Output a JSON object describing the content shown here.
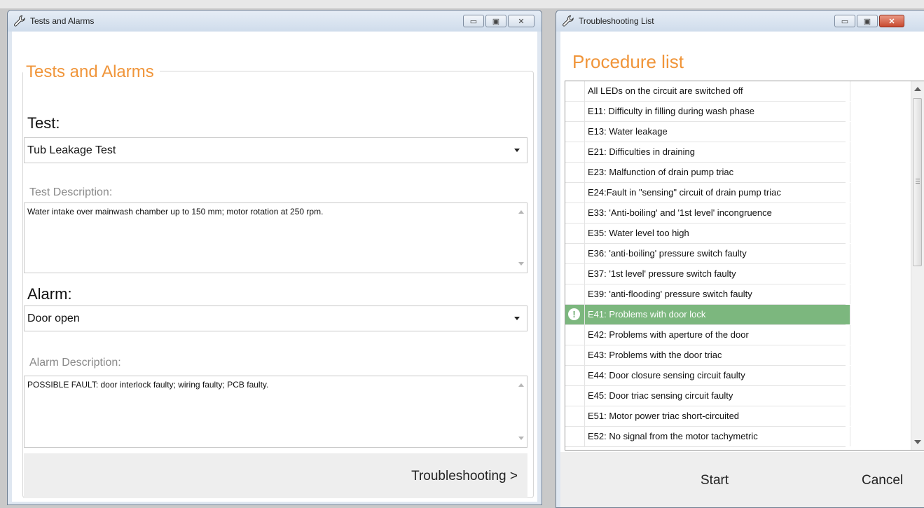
{
  "tests_window": {
    "title": "Tests and Alarms",
    "group_title": "Tests and Alarms",
    "test_label": "Test:",
    "test_value": "Tub Leakage Test",
    "test_desc_label": "Test Description:",
    "test_desc": "Water intake over mainwash chamber up to 150 mm; motor rotation at 250 rpm.",
    "alarm_label": "Alarm:",
    "alarm_value": "Door open",
    "alarm_desc_label": "Alarm Description:",
    "alarm_desc": "POSSIBLE FAULT: door interlock faulty; wiring faulty; PCB faulty.",
    "troubleshooting_button": "Troubleshooting >"
  },
  "troubleshooting_window": {
    "title": "Troubleshooting List",
    "heading": "Procedure list",
    "items": [
      {
        "label": "All LEDs on the circuit are switched off",
        "selected": false
      },
      {
        "label": "E11: Difficulty in filling during wash phase",
        "selected": false
      },
      {
        "label": "E13: Water leakage",
        "selected": false
      },
      {
        "label": "E21: Difficulties in draining",
        "selected": false
      },
      {
        "label": "E23: Malfunction of drain pump triac",
        "selected": false
      },
      {
        "label": "E24:Fault in \"sensing\" circuit of drain pump triac",
        "selected": false
      },
      {
        "label": "E33: 'Anti-boiling' and '1st level' incongruence",
        "selected": false
      },
      {
        "label": "E35: Water level too high",
        "selected": false
      },
      {
        "label": "E36: 'anti-boiling' pressure switch faulty",
        "selected": false
      },
      {
        "label": "E37: '1st level' pressure switch faulty",
        "selected": false
      },
      {
        "label": "E39: 'anti-flooding' pressure switch faulty",
        "selected": false
      },
      {
        "label": "E41: Problems with door lock",
        "selected": true
      },
      {
        "label": "E42: Problems with aperture of the door",
        "selected": false
      },
      {
        "label": "E43: Problems with the door triac",
        "selected": false
      },
      {
        "label": "E44: Door closure sensing circuit faulty",
        "selected": false
      },
      {
        "label": "E45: Door triac sensing circuit faulty",
        "selected": false
      },
      {
        "label": "E51: Motor power triac short-circuited",
        "selected": false
      },
      {
        "label": "E52: No signal from the motor tachymetric",
        "selected": false
      }
    ],
    "start_button": "Start",
    "cancel_button": "Cancel"
  },
  "colors": {
    "accent_orange": "#f0953a",
    "selected_row": "#7cb77e",
    "close_red": "#c8492f"
  }
}
